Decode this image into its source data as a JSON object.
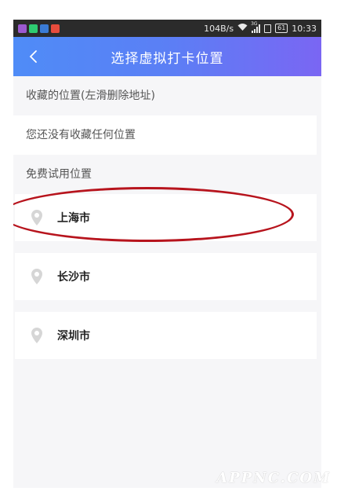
{
  "status_bar": {
    "app_icon_colors": [
      "#9b59d0",
      "#2ecc71",
      "#3a7bd5",
      "#e74c3c"
    ],
    "net_speed": "104B/s",
    "network": "3G",
    "battery": "61",
    "time": "10:33"
  },
  "header": {
    "back_icon": "chevron-left-icon",
    "title": "选择虚拟打卡位置",
    "gradient": [
      "#4f8cf7",
      "#7a66f3"
    ]
  },
  "favorites": {
    "label": "收藏的位置(左滑删除地址)",
    "empty_text": "您还没有收藏任何位置"
  },
  "trial": {
    "label": "免费试用位置",
    "items": [
      {
        "label": "上海市",
        "icon": "location-pin-icon",
        "highlighted": true
      },
      {
        "label": "长沙市",
        "icon": "location-pin-icon",
        "highlighted": false
      },
      {
        "label": "深圳市",
        "icon": "location-pin-icon",
        "highlighted": false
      }
    ]
  },
  "annotation_color": "#b7141d",
  "watermark": "APPNC.COM"
}
